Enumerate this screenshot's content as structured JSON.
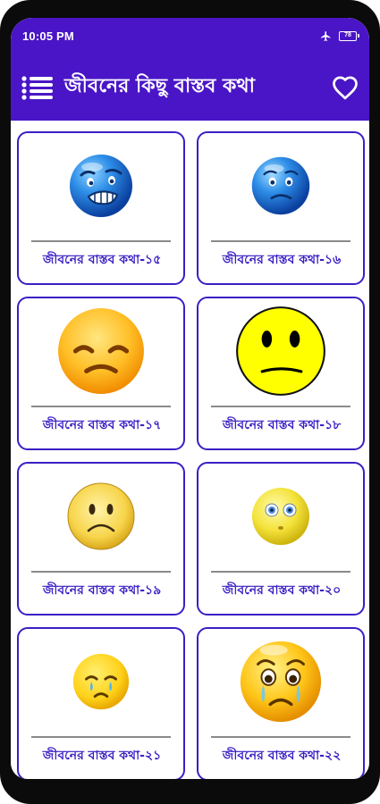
{
  "status_bar": {
    "time": "10:05 PM",
    "battery": "78",
    "airplane_icon": "airplane-icon",
    "battery_icon": "battery-icon"
  },
  "app_bar": {
    "title": "জীবনের কিছু বাস্তব কথা",
    "menu_icon": "menu-list-icon",
    "favorite_icon": "heart-outline-icon"
  },
  "theme": {
    "primary": "#4a15c6",
    "card_border": "#3a1fc4",
    "label_color": "#3a1fc4"
  },
  "cards": [
    {
      "label": "জীবনের বাস্তব কথা-১৫",
      "emoji": "blue-grimacing-face"
    },
    {
      "label": "জীবনের বাস্তব কথা-১৬",
      "emoji": "blue-worried-face"
    },
    {
      "label": "জীবনের বাস্তব কথা-১৭",
      "emoji": "pensive-sad-face"
    },
    {
      "label": "জীবনের বাস্তব কথা-১৮",
      "emoji": "yellow-neutral-face"
    },
    {
      "label": "জীবনের বাস্তব কথা-১৯",
      "emoji": "yellow-frowning-face"
    },
    {
      "label": "জীবনের বাস্তব কথা-২০",
      "emoji": "yellow-dazed-face"
    },
    {
      "label": "জীবনের বাস্তব কথা-২১",
      "emoji": "yellow-crying-face"
    },
    {
      "label": "জীবনের বাস্তব কথা-২২",
      "emoji": "yellow-sobbing-face"
    }
  ]
}
